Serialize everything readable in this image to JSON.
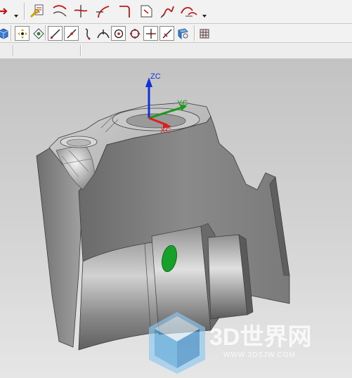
{
  "toolbar_top": {
    "icons": [
      "run-arrow-icon",
      "edit-properties-icon",
      "curve-tool-icon",
      "trim-curve-icon",
      "fillet-curve-icon",
      "corner-curve-icon",
      "sheet-document-icon",
      "spline-icon",
      "blend-curve-icon"
    ]
  },
  "toolbar_snap": {
    "icons": [
      "view-cube-icon",
      "snap-point-icon",
      "snap-settings-icon",
      "line-snap-icon",
      "endpoint-snap-icon",
      "curve-snap-icon",
      "tangent-snap-icon",
      "circle-center-icon",
      "quadrant-icon",
      "intersection-icon",
      "midpoint-icon",
      "view-icon",
      "grid-icon"
    ]
  },
  "viewport": {
    "axes": {
      "z": "ZC",
      "y": "YC",
      "x": "XC"
    },
    "colors": {
      "z": "#1030d8",
      "y": "#1a9a1a",
      "x": "#d82020",
      "model": "#7a7a7a",
      "hole": "#17a02a"
    },
    "watermark": {
      "brand": "3D世界网",
      "url": "WWW.3DSJW.COM"
    }
  }
}
